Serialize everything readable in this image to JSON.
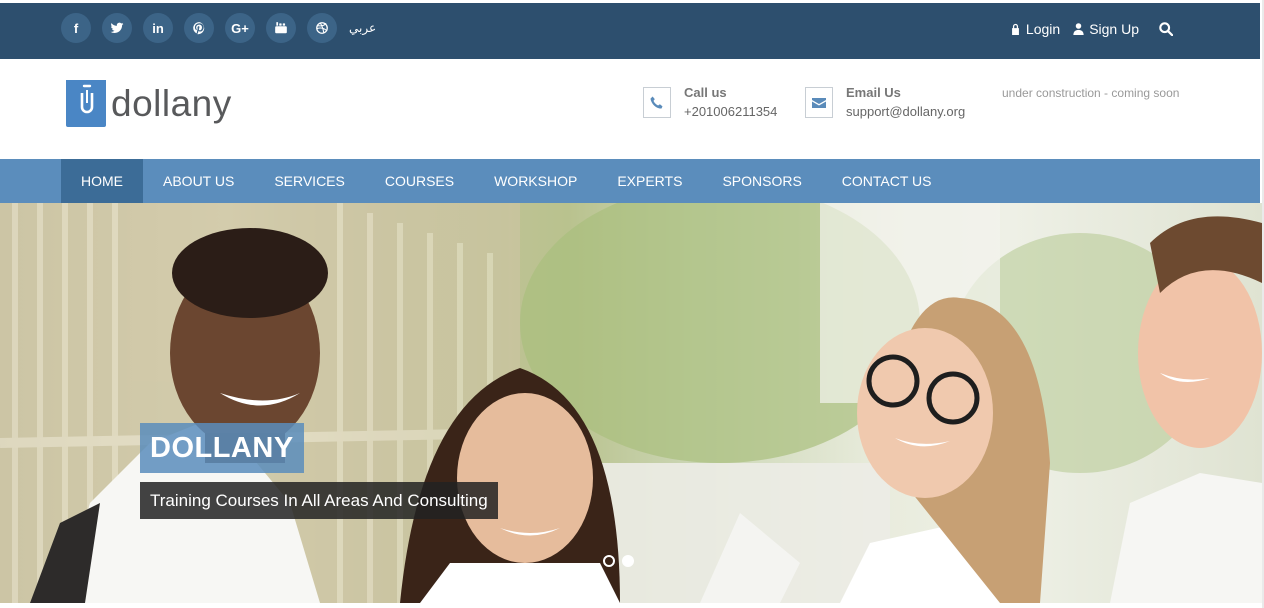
{
  "topbar": {
    "social": [
      {
        "icon": "facebook-icon",
        "glyph": "f"
      },
      {
        "icon": "twitter-icon",
        "glyph": ""
      },
      {
        "icon": "linkedin-icon",
        "glyph": "in"
      },
      {
        "icon": "pinterest-icon",
        "glyph": ""
      },
      {
        "icon": "google-plus-icon",
        "glyph": "G+"
      },
      {
        "icon": "youtube-icon",
        "glyph": ""
      },
      {
        "icon": "dribbble-icon",
        "glyph": ""
      }
    ],
    "language": "عربي",
    "login_label": "Login",
    "signup_label": "Sign Up"
  },
  "header": {
    "logo_text": "dollany",
    "call_title": "Call us",
    "call_value": "+201006211354",
    "email_title": "Email Us",
    "email_value": "support@dollany.org",
    "notice": "under construction - coming soon"
  },
  "nav": {
    "items": [
      "HOME",
      "ABOUT US",
      "SERVICES",
      "COURSES",
      "WORKSHOP",
      "EXPERTS",
      "SPONSORS",
      "CONTACT US"
    ],
    "active_index": 0
  },
  "hero": {
    "title": "DOLLANY",
    "subtitle": "Training Courses In All Areas And Consulting",
    "slides_count": 2,
    "active_slide": 1
  },
  "colors": {
    "topbar": "#2d4f6e",
    "nav": "#5b8dbc",
    "nav_active": "#3c6c97",
    "accent": "#4a86c5"
  }
}
